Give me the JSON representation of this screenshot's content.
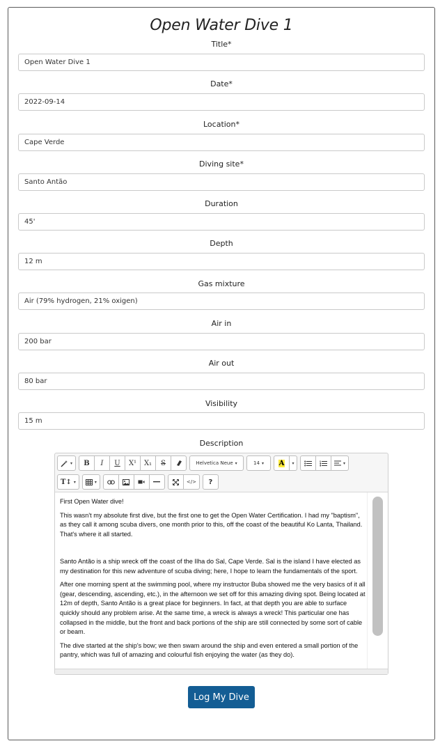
{
  "form": {
    "title": "Open Water Dive 1",
    "fields": [
      {
        "label": "Title*",
        "value": "Open Water Dive 1"
      },
      {
        "label": "Date*",
        "value": "2022-09-14"
      },
      {
        "label": "Location*",
        "value": "Cape Verde"
      },
      {
        "label": "Diving site*",
        "value": "Santo Antão"
      },
      {
        "label": "Duration",
        "value": "45'"
      },
      {
        "label": "Depth",
        "value": "12 m"
      },
      {
        "label": "Gas mixture",
        "value": "Air (79% hydrogen, 21% oxigen)"
      },
      {
        "label": "Air in",
        "value": "200 bar"
      },
      {
        "label": "Air out",
        "value": "80 bar"
      },
      {
        "label": "Visibility",
        "value": "15 m"
      }
    ],
    "description_label": "Description",
    "submit_label": "Log My Dive"
  },
  "editor": {
    "toolbar": {
      "font_name": "Helvetica Neue",
      "font_size": "14",
      "bold": "B",
      "italic": "I",
      "underline": "U",
      "superscript": "X¹",
      "subscript": "X₁",
      "strikethrough": "S",
      "color": "A",
      "help": "?"
    },
    "paragraphs": [
      "First Open Water dive!",
      "This wasn't my absolute first dive, but the first one to get the Open Water Certification. I had my \"baptism\", as they call it among scuba divers, one month prior to this, off the coast of the beautiful Ko Lanta, Thailand. That's where it all started.",
      "",
      "Santo Antão is a ship wreck off the coast of the Ilha do Sal, Cape Verde. Sal is the island I have elected as my destination for this new adventure of scuba diving; here, I hope to learn the fundamentals of the sport.",
      "After one morning spent at the swimming pool, where my instructor Buba showed me the very basics of it all (gear, descending, ascending, etc.), in the afternoon we set off for this amazing diving spot. Being located at 12m of depth, Santo Antão is a great place for beginners. In fact, at that depth you are able to surface quickly should any problem arise. At the same time, a wreck is always a wreck! This particular one has collapsed in the middle, but the front and back portions of the ship are still connected by some sort of cable or beam.",
      "The dive started at the ship's bow; we then swam around the ship and even entered a small portion of the pantry, which was full of amazing and colourful fish enjoying the water (as they do)."
    ]
  },
  "colors": {
    "accent": "#135d94",
    "highlight": "#ffeb3b"
  }
}
